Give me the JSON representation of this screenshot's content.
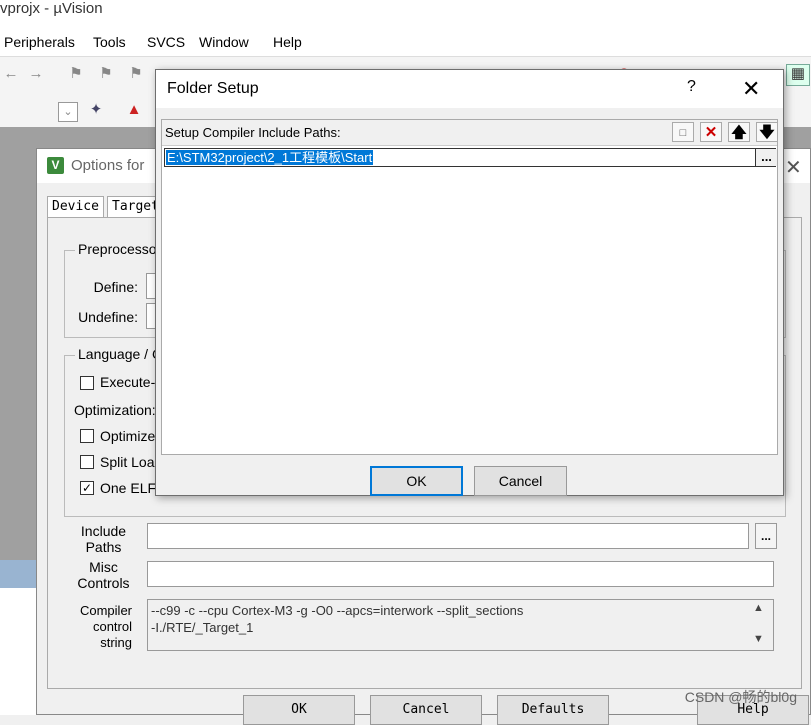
{
  "app": {
    "title": "vprojx - µVision"
  },
  "menu": [
    "Peripherals",
    "Tools",
    "SVCS",
    "Window",
    "Help"
  ],
  "options_dialog": {
    "title": "Options for",
    "tabs": [
      "Device",
      "Target"
    ],
    "preprocessor_group": "Preprocessor",
    "define_label": "Define:",
    "undefine_label": "Undefine:",
    "language_group": "Language / C",
    "execute_label": "Execute-o",
    "optimization_label": "Optimization:",
    "optimize_label": "Optimize f",
    "split_load_label": "Split Load",
    "one_elf_label": "One ELF S",
    "include_paths_label_1": "Include",
    "include_paths_label_2": "Paths",
    "include_paths_dots": "...",
    "misc_label_1": "Misc",
    "misc_label_2": "Controls",
    "compiler_label_1": "Compiler",
    "compiler_label_2": "control",
    "compiler_label_3": "string",
    "compiler_string_line1": "--c99 -c --cpu Cortex-M3 -g -O0 --apcs=interwork --split_sections",
    "compiler_string_line2": "-I./RTE/_Target_1",
    "buttons": {
      "ok": "OK",
      "cancel": "Cancel",
      "defaults": "Defaults",
      "help": "Help"
    }
  },
  "folder_setup": {
    "title": "Folder Setup",
    "help_glyph": "?",
    "close_glyph": "✕",
    "header_label": "Setup Compiler Include Paths:",
    "paths": [
      "E:\\STM32project\\2_1工程模板\\Start"
    ],
    "browse_label": "...",
    "ok_label": "OK",
    "cancel_label": "Cancel"
  },
  "watermark": "CSDN @畅的bl0g",
  "colors": {
    "selection": "#0078d7",
    "taskbar_strip": "#99b4d1"
  }
}
